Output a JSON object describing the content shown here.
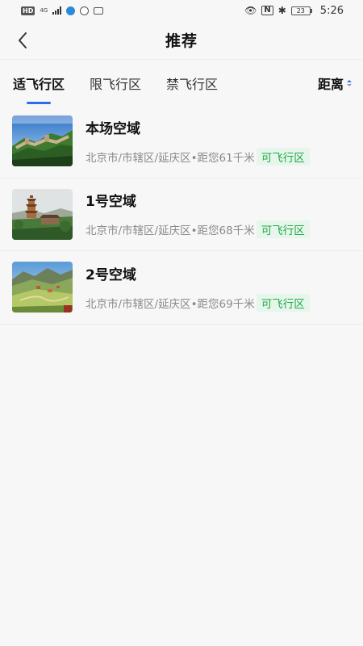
{
  "status_bar": {
    "left_icons": [
      "hd-icon",
      "signal-icon",
      "app-icon-1",
      "app-icon-2",
      "app-icon-3"
    ],
    "right_icons": [
      "eye-icon",
      "nfc-icon",
      "bluetooth-icon",
      "battery-icon"
    ],
    "hd": "HD",
    "net": "4G",
    "battery": "23",
    "time": "5:26"
  },
  "nav": {
    "title": "推荐",
    "back_icon": "chevron-left-icon"
  },
  "tabs": [
    {
      "label": "适飞行区",
      "active": true
    },
    {
      "label": "限飞行区",
      "active": false
    },
    {
      "label": "禁飞行区",
      "active": false
    }
  ],
  "sort": {
    "label": "距离",
    "icon": "sort-arrows-icon"
  },
  "items": [
    {
      "title": "本场空域",
      "location": "北京市/市辖区/延庆区•距您61千米",
      "badge": "可飞行区",
      "image": "great-wall-photo"
    },
    {
      "title": "1号空域",
      "location": "北京市/市辖区/延庆区•距您68千米",
      "badge": "可飞行区",
      "image": "pagoda-photo"
    },
    {
      "title": "2号空域",
      "location": "北京市/市辖区/延庆区•距您69千米",
      "badge": "可飞行区",
      "image": "valley-village-photo"
    }
  ],
  "colors": {
    "accent": "#2a6de6",
    "badge_text": "#22a84a",
    "badge_bg": "#e7f6eb",
    "background": "#f7f7f7"
  }
}
